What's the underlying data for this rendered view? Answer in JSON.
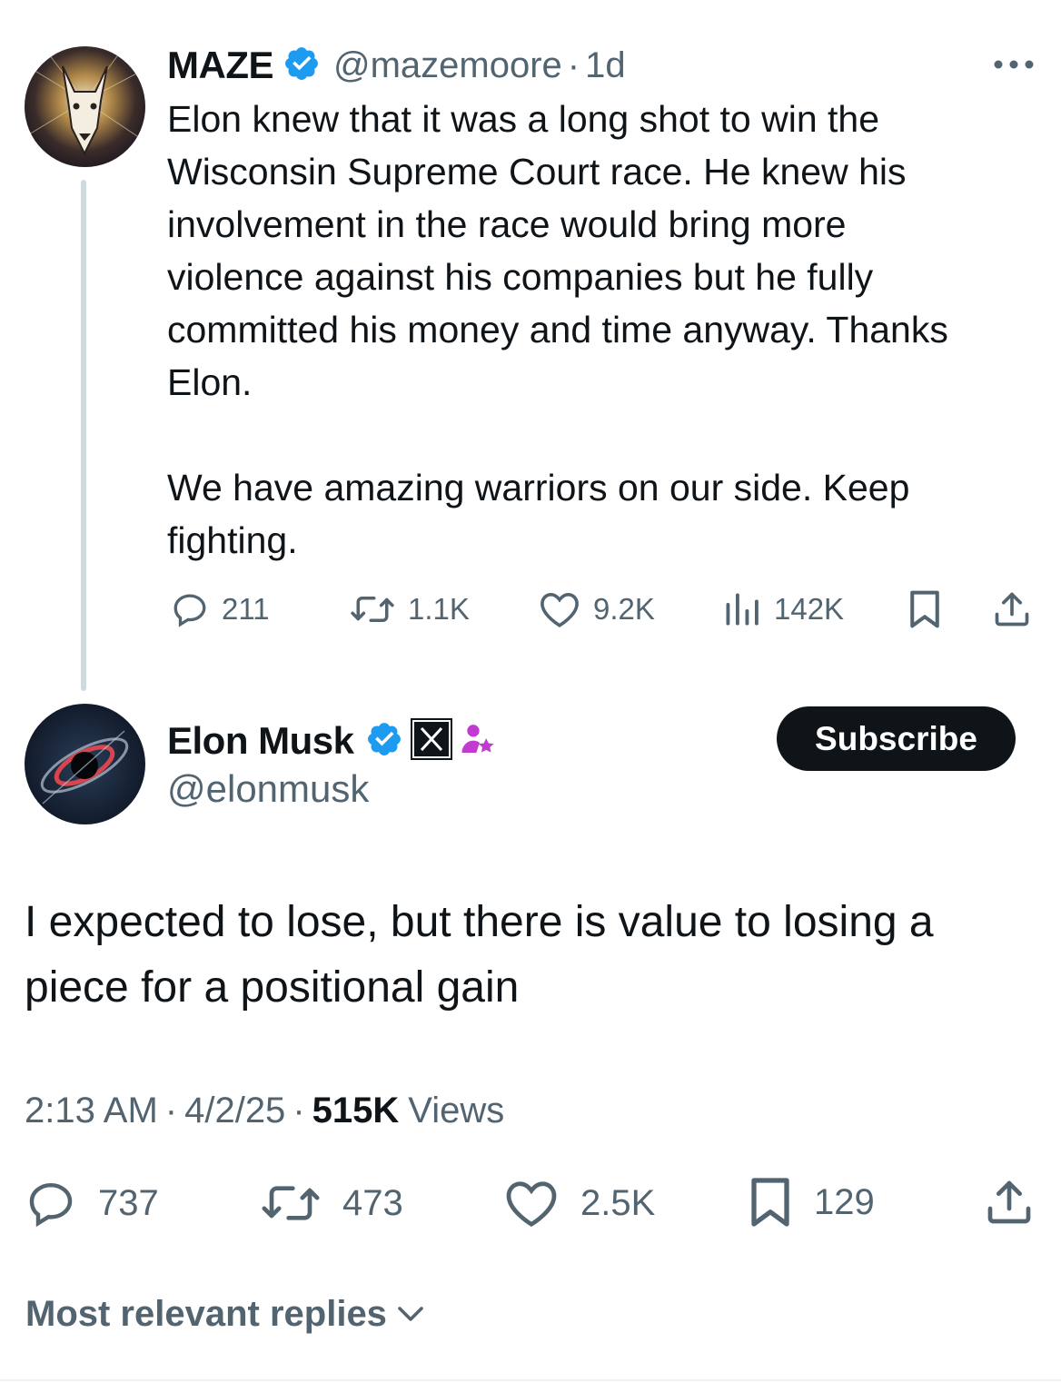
{
  "first_tweet": {
    "name": "MAZE",
    "handle": "@mazemoore",
    "separator": "·",
    "age": "1d",
    "more_icon": "ellipsis-icon",
    "text": "Elon knew that it was a long shot to win the\nWisconsin Supreme Court race. He knew his\ninvolvement in the race would bring more\nviolence against his companies but he fully\ncommitted his money and time anyway. Thanks\nElon.\n\nWe have amazing warriors on our side. Keep\nfighting.",
    "actions": {
      "replies": "211",
      "reposts": "1.1K",
      "likes": "9.2K",
      "views": "142K"
    }
  },
  "main_tweet": {
    "name": "Elon Musk",
    "handle": "@elonmusk",
    "subscribe_label": "Subscribe",
    "text": "I expected to lose, but there is value to losing a\npiece for a positional gain",
    "time": "2:13 AM",
    "date": "4/2/25",
    "sep": "·",
    "views_count": "515K",
    "views_label": "Views",
    "actions": {
      "replies": "737",
      "reposts": "473",
      "likes": "2.5K",
      "bookmarks": "129"
    }
  },
  "replies_sort": {
    "label": "Most relevant replies",
    "icon": "chevron-down-icon"
  },
  "colors": {
    "verified_blue": "#1d9bf0",
    "text": "#0f1419",
    "muted": "#536471",
    "thread_line": "#cfd9de",
    "affiliate_badge": "#c13bd1"
  }
}
